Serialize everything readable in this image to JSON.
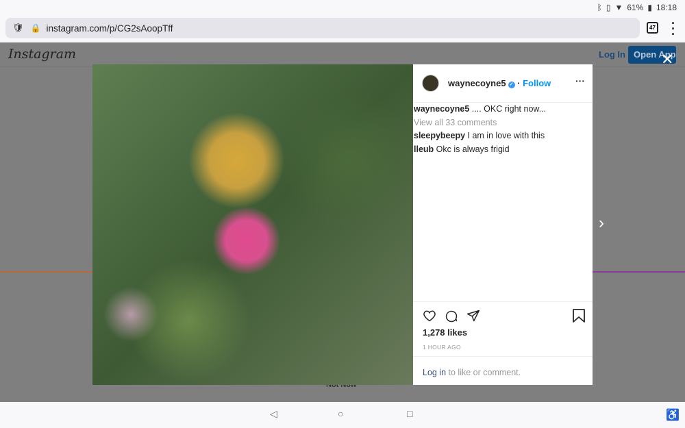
{
  "status_bar": {
    "battery": "61%",
    "time": "18:18"
  },
  "browser": {
    "url": "instagram.com/p/CG2sAoopTff",
    "tab_count": "47"
  },
  "instagram_bar": {
    "logo": "Instagram",
    "login": "Log In",
    "open_app": "Open App"
  },
  "background": {
    "not_now": "Not Now"
  },
  "post": {
    "username": "wayneCoyne5",
    "follow": "Follow",
    "caption_user": "waynecoyne5",
    "caption": ".... OKC right now...",
    "view_all": "View all 33 comments",
    "comments": [
      {
        "user": "sleepybeepy",
        "text": "I am in love with this"
      },
      {
        "user": "lleub",
        "text": "Okc is always frigid"
      }
    ],
    "likes": "1,278 likes",
    "time": "1 HOUR AGO",
    "login_link": "Log in",
    "login_text": " to like or comment."
  },
  "colors": {
    "accent": "#0095f6",
    "open_app_bg": "#0d4a80"
  }
}
